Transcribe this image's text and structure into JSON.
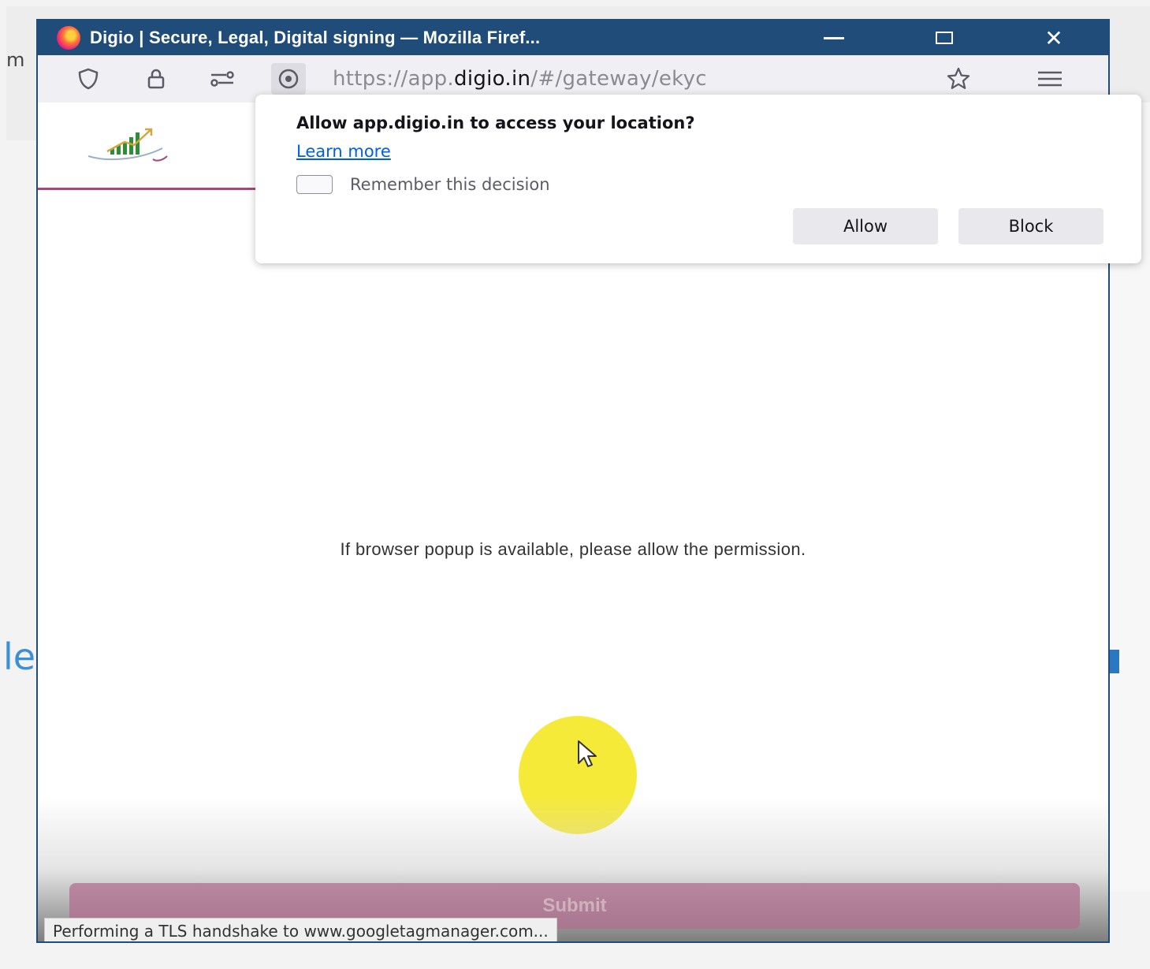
{
  "background": {
    "left_text": "m",
    "left_big_text": "le"
  },
  "window": {
    "title": "Digio | Secure, Legal, Digital signing — Mozilla Firef...",
    "minimize_icon": "minimize-icon",
    "maximize_icon": "maximize-icon",
    "close_icon": "close-icon",
    "close_glyph": "✕",
    "accent_color": "#1f4c78"
  },
  "navbar": {
    "url_prefix": "https://app.",
    "url_domain": "digio.in",
    "url_path": "/#/gateway/ekyc",
    "icons": [
      "shield-icon",
      "lock-icon",
      "permissions-icon",
      "location-icon",
      "star-icon",
      "menu-icon"
    ]
  },
  "permission_popup": {
    "title": "Allow app.digio.in to access your location?",
    "learn_more": "Learn more",
    "remember_label": "Remember this decision",
    "remember_checked": false,
    "allow_label": "Allow",
    "block_label": "Block"
  },
  "page": {
    "message": "If browser popup is available, please allow the permission.",
    "submit_label": "Submit",
    "brand_color": "#a14a7b"
  },
  "status_bar": {
    "text": "Performing a TLS handshake to www.googletagmanager.com..."
  }
}
